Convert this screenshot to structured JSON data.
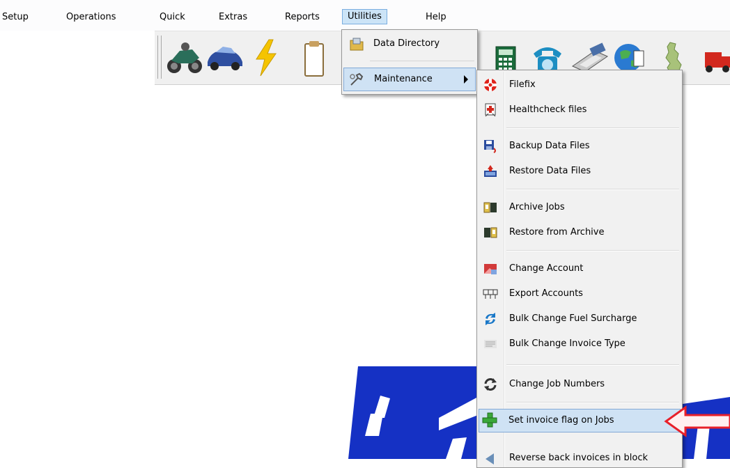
{
  "menubar": {
    "items": [
      {
        "label": "Setup"
      },
      {
        "label": "Operations"
      },
      {
        "label": "Quick"
      },
      {
        "label": "Extras"
      },
      {
        "label": "Reports"
      },
      {
        "label": "Utilities"
      },
      {
        "label": "Help"
      }
    ],
    "active": "Utilities"
  },
  "toolbar": {
    "buttons": [
      {
        "icon": "motorbike-icon"
      },
      {
        "icon": "car-icon"
      },
      {
        "icon": "lightning-icon"
      },
      {
        "icon": "clipboard-icon"
      },
      {
        "icon": "calculator-icon"
      },
      {
        "icon": "telephone-icon"
      },
      {
        "icon": "scanner-icon"
      },
      {
        "icon": "globe-icon"
      },
      {
        "icon": "map-icon"
      },
      {
        "icon": "truck-icon"
      }
    ]
  },
  "utilities_menu": {
    "items": [
      {
        "label": "Data Directory",
        "icon": "folder-icon"
      },
      {
        "label": "Maintenance",
        "icon": "wrench-icon",
        "has_submenu": true,
        "highlighted": true
      }
    ]
  },
  "maintenance_menu": {
    "items": [
      {
        "label": "Filefix",
        "icon": "lifebuoy-icon"
      },
      {
        "label": "Healthcheck files",
        "icon": "medical-icon"
      },
      {
        "label": "Backup Data Files",
        "icon": "floppy-icon"
      },
      {
        "label": "Restore Data Files",
        "icon": "restore-icon"
      },
      {
        "label": "Archive Jobs",
        "icon": "archive-icon"
      },
      {
        "label": "Restore from Archive",
        "icon": "archive-restore-icon"
      },
      {
        "label": "Change Account",
        "icon": "account-icon"
      },
      {
        "label": "Export Accounts",
        "icon": "export-icon"
      },
      {
        "label": "Bulk Change Fuel Surcharge",
        "icon": "refresh-blue-icon"
      },
      {
        "label": "Bulk Change Invoice Type",
        "icon": "invoice-icon"
      },
      {
        "label": "Change Job Numbers",
        "icon": "renumber-icon"
      },
      {
        "label": "Set invoice flag on Jobs",
        "icon": "plus-icon",
        "highlighted": true
      },
      {
        "label": "Reverse back invoices in block",
        "icon": "reverse-icon"
      }
    ]
  },
  "colors": {
    "highlight": "#cfe2f4",
    "arrow": "#e8202a",
    "logo": "#1531c4"
  }
}
